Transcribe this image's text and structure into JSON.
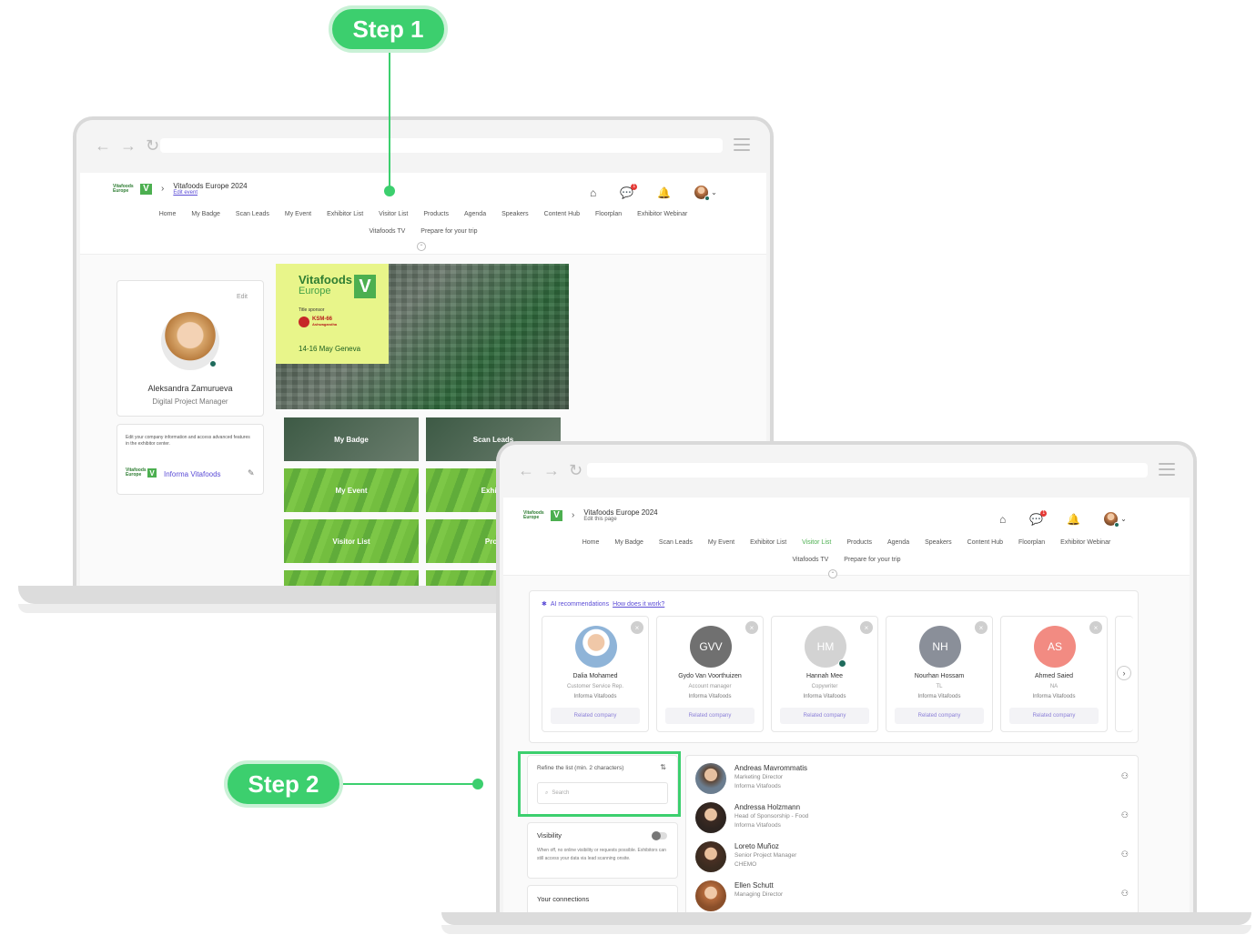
{
  "steps": {
    "step1": "Step 1",
    "step2": "Step 2"
  },
  "colors": {
    "accent": "#3ccf6e",
    "brand_green": "#4caf50",
    "link_purple": "#5b4cd6"
  },
  "app": {
    "event_title": "Vitafoods Europe 2024",
    "edit_event": "Edit event",
    "edit_this_page": "Edit this page",
    "logo_word": "Vitafoods Europe",
    "logo_v": "V",
    "menu": [
      "Home",
      "My Badge",
      "Scan Leads",
      "My Event",
      "Exhibitor List",
      "Visitor List",
      "Products",
      "Agenda",
      "Speakers",
      "Content Hub",
      "Floorplan",
      "Exhibitor Webinar"
    ],
    "menu2": [
      "Vitafoods TV",
      "Prepare for your trip"
    ],
    "notif_count": "1",
    "icons": [
      "home-icon",
      "chat-icon",
      "bell-icon",
      "chevron-down-icon"
    ]
  },
  "laptop1": {
    "edit_label": "Edit",
    "profile_name": "Aleksandra Zamurueva",
    "profile_role": "Digital Project Manager",
    "company_note": "Edit your company information and access advanced features in the exhibitor center.",
    "company_name": "Informa Vitafoods",
    "hero": {
      "brand_line1": "Vitafoods",
      "brand_line2": "Europe",
      "v": "V",
      "sponsor_label": "Title sponsor",
      "sponsor_name": "KSM-66",
      "sponsor_sub": "Ashwagandha",
      "dates": "14-16 May Geneva"
    },
    "tiles": [
      "My Badge",
      "Scan Leads",
      "My Event",
      "Exhibit",
      "Visitor List",
      "Prod"
    ]
  },
  "laptop2": {
    "ai_title": "AI recommendations",
    "ai_link": "How does it work?",
    "recommendations": [
      {
        "name": "Dalia Mohamed",
        "role": "Customer Service Rep.",
        "company": "Informa Vitafoods",
        "initials": "",
        "color": "#c9a88a",
        "button": "Related company"
      },
      {
        "name": "Gydo Van Voorthuizen",
        "role": "Account manager",
        "company": "Informa Vitafoods",
        "initials": "GVV",
        "color": "#707070",
        "button": "Related company"
      },
      {
        "name": "Hannah Mee",
        "role": "Copywriter",
        "company": "Informa Vitafoods",
        "initials": "HM",
        "color": "#d3d3d3",
        "button": "Related company"
      },
      {
        "name": "Nourhan Hossam",
        "role": "TL",
        "company": "Informa Vitafoods",
        "initials": "NH",
        "color": "#8a8f99",
        "button": "Related company"
      },
      {
        "name": "Ahmed Saied",
        "role": "NA",
        "company": "Informa Vitafoods",
        "initials": "AS",
        "color": "#f28b82",
        "button": "Related company"
      }
    ],
    "refine_label": "Refine the list (min. 2 characters)",
    "search_placeholder": "Search",
    "visibility_title": "Visibility",
    "visibility_text": "When off, no online visibility or requests possible. Exhibitors can still access your data via lead scanning onsite.",
    "connections_title": "Your connections",
    "people": [
      {
        "name": "Andreas Mavrommatis",
        "role": "Marketing Director",
        "company": "Informa Vitafoods"
      },
      {
        "name": "Andressa Holzmann",
        "role": "Head of Sponsorship - Food",
        "company": "Informa Vitafoods"
      },
      {
        "name": "Loreto Muñoz",
        "role": "Senior Project Manager",
        "company": "CHEMO"
      },
      {
        "name": "Ellen Schutt",
        "role": "Managing Director",
        "company": ""
      }
    ]
  }
}
